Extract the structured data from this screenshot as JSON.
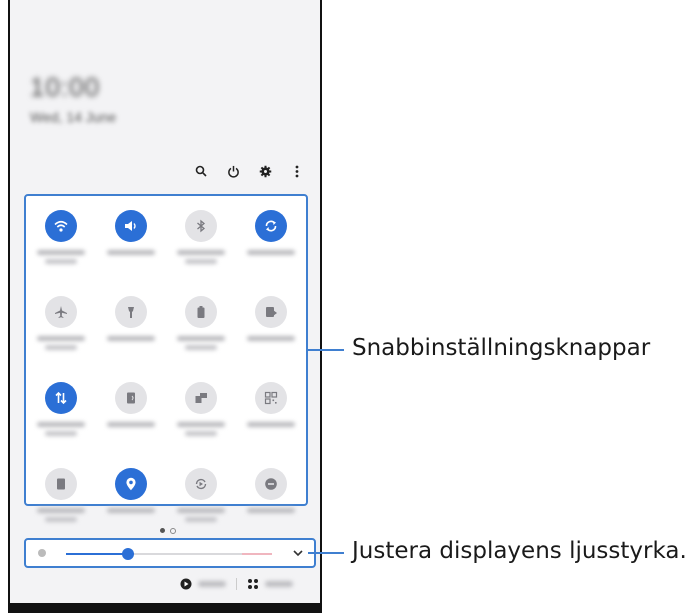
{
  "status": {
    "time": "10:00",
    "date": "Wed, 14 June"
  },
  "top_icons": [
    "search-icon",
    "power-icon",
    "gear-icon",
    "more-vertical-icon"
  ],
  "tiles": [
    {
      "name": "wifi",
      "icon": "wifi-icon",
      "on": true
    },
    {
      "name": "sound",
      "icon": "volume-icon",
      "on": true
    },
    {
      "name": "bluetooth",
      "icon": "bluetooth-icon",
      "on": false
    },
    {
      "name": "auto-rotate",
      "icon": "rotate-icon",
      "on": true
    },
    {
      "name": "airplane",
      "icon": "airplane-icon",
      "on": false
    },
    {
      "name": "flashlight",
      "icon": "flashlight-icon",
      "on": false
    },
    {
      "name": "power-saving",
      "icon": "battery-icon",
      "on": false
    },
    {
      "name": "wireless-share",
      "icon": "share-icon",
      "on": false
    },
    {
      "name": "mobile-data",
      "icon": "data-arrows-icon",
      "on": true
    },
    {
      "name": "mobile-hotspot",
      "icon": "hotspot-icon",
      "on": false
    },
    {
      "name": "link-windows",
      "icon": "link-icon",
      "on": false
    },
    {
      "name": "scan-qr",
      "icon": "qr-icon",
      "on": false
    },
    {
      "name": "secure-folder",
      "icon": "folder-icon",
      "on": false
    },
    {
      "name": "location",
      "icon": "location-icon",
      "on": true
    },
    {
      "name": "smart-view",
      "icon": "smart-view-icon",
      "on": false
    },
    {
      "name": "do-not-disturb",
      "icon": "dnd-icon",
      "on": false
    }
  ],
  "brightness_level": 0.3,
  "callouts": {
    "quick_settings": "Snabbinställningsknappar",
    "brightness": "Justera displayens ljusstyrka."
  },
  "colors": {
    "accent": "#2b6fd6",
    "callout": "#3f7fd0"
  }
}
